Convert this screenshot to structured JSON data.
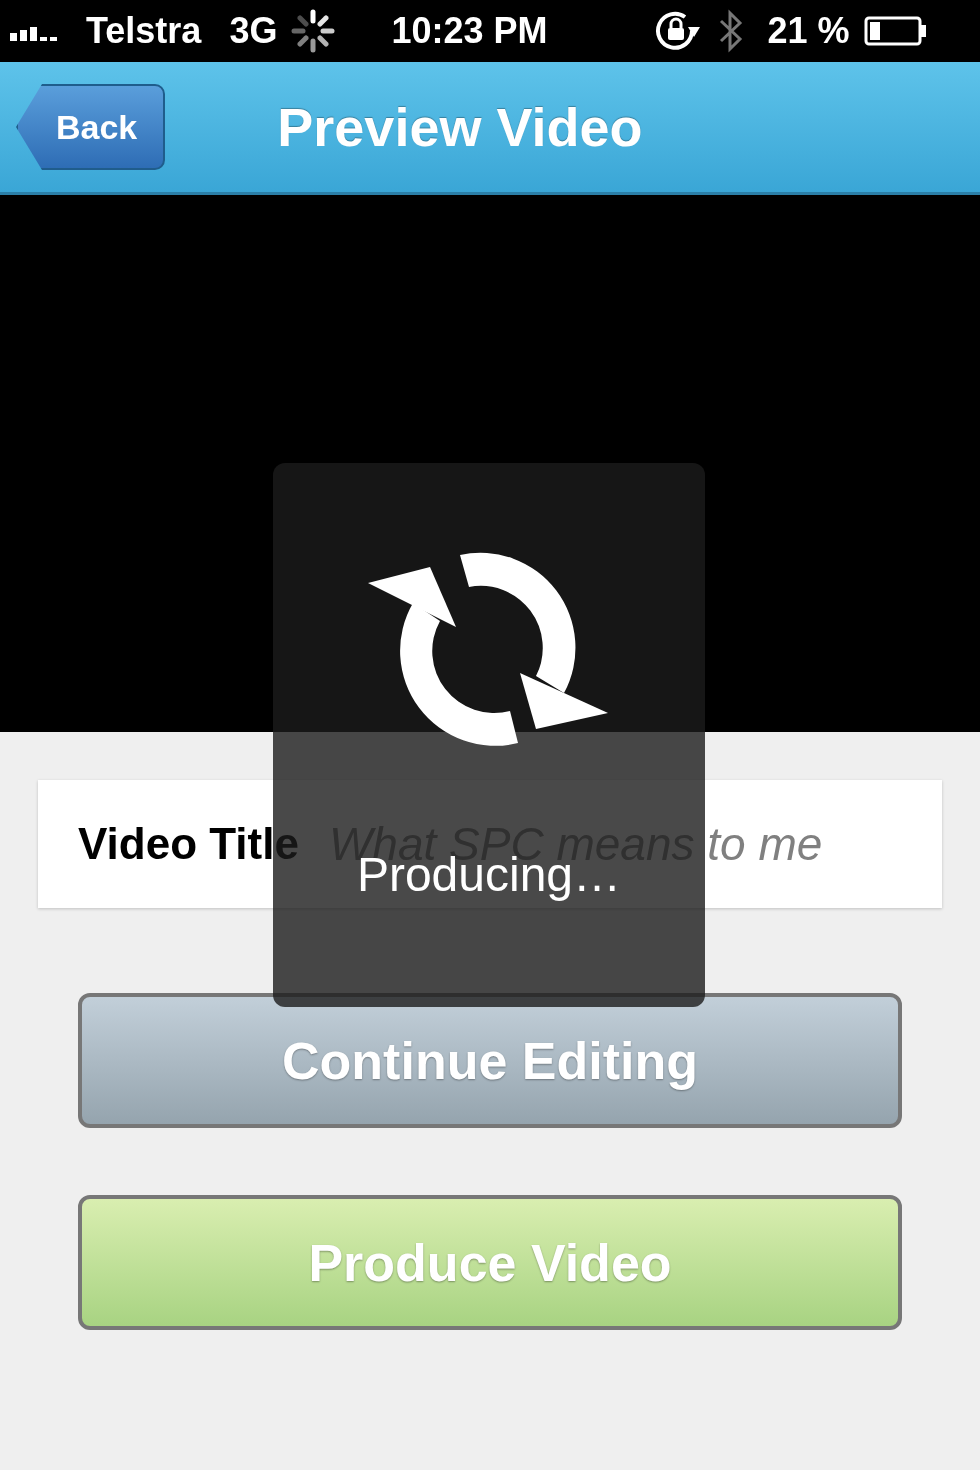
{
  "status_bar": {
    "carrier": "Telstra",
    "network": "3G",
    "time": "10:23 PM",
    "battery": "21 %"
  },
  "nav_bar": {
    "back": "Back",
    "title": "Preview Video"
  },
  "title_field": {
    "label": "Video Title",
    "placeholder": "What SPC means to me"
  },
  "buttons": [
    {
      "label": "Continue Editing",
      "kind": "secondary"
    },
    {
      "label": "Produce Video",
      "kind": "primary"
    }
  ],
  "overlay": {
    "message": "Producing…"
  }
}
